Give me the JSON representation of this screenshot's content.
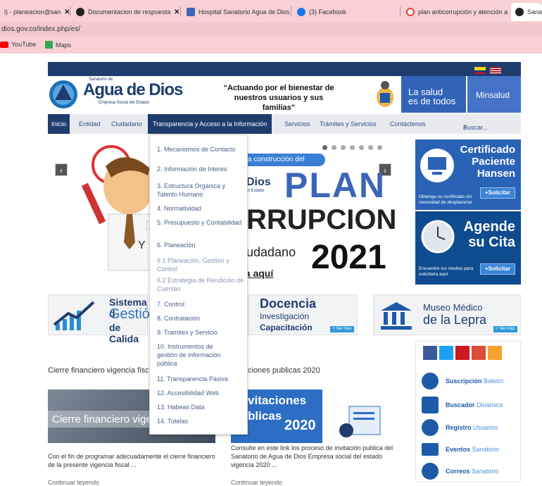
{
  "browser": {
    "tabs": [
      {
        "title": "l) - planeacion@san",
        "favicon_color": "#999999"
      },
      {
        "title": "Documentacion de respuesta",
        "favicon_color": "#222222"
      },
      {
        "title": "Hospital Sanatorio Agua de Dios",
        "favicon_color": "#3b66b8"
      },
      {
        "title": "(3) Facebook",
        "favicon_color": "#1877f2"
      },
      {
        "title": "plan anticorrupción y atención a",
        "favicon_color": "#ea4335"
      },
      {
        "title": "Sanato",
        "favicon_color": "#222222"
      }
    ],
    "tab_close": "✕",
    "url": "dios.gov.co/index.php/es/",
    "bookmarks": [
      {
        "label": "YouTube",
        "color": "#ff0000"
      },
      {
        "label": "Maps",
        "color": "#34a853"
      }
    ]
  },
  "header": {
    "logo_small": "Sanatorio de",
    "logo_main": "Agua de Dios",
    "logo_sub": "Empresa Social del Estado",
    "slogan": "“Actuando por el bienestar de nuestros usuarios y sus familias”",
    "salud_line1": "La salud",
    "salud_line2": "es de todos",
    "minsalud": "Minsalud"
  },
  "nav": {
    "items": [
      "Inicio",
      "Entidad",
      "Ciudadano",
      "Transparencia y Acceso a la Información",
      "Servicios",
      "Trámites y Servicios",
      "Contáctenos"
    ],
    "search_placeholder": "Buscar..."
  },
  "dropdown": {
    "items": [
      "1. Mecanismos de Contacto",
      "2. Información de Interes",
      "3. Estructura Orgánica y Talento Humano",
      "4. Normatividad",
      "5. Presupuesto y Contabilidad",
      "6. Planeación",
      "6.1 Planeación, Gestión y Control",
      "6.2 Estrategia de Rendición de Cuentas",
      "7. Control",
      "8. Contratación",
      "9. Tramites y Servicio",
      "10. Instrumentos de gestión de información pública",
      "11. Transparencia Pasiva",
      "12. Accesibilidad Web",
      "13. Habeas Data",
      "14. Tutelas"
    ]
  },
  "slider": {
    "pill": "a construcción del",
    "logo": "Dios",
    "logo_sub": "el Estado",
    "plan": "PLAN",
    "corr": "RRUPCION",
    "ciudadano": "udadano",
    "year": "2021",
    "aqui": "sa aquí",
    "y": "Y",
    "prev": "‹",
    "next": "›"
  },
  "side": {
    "hansen_title": "Certificado Paciente Hansen",
    "hansen_small": "Obtenga su certificado sin necesidad de desplazarse",
    "solicitar": "+Solicitar",
    "cita_line1": "Agende",
    "cita_line2": "su Cita",
    "cita_small": "Encuentre los medios para solicitarla aquí"
  },
  "banners": {
    "calidad_line1": "Sistema d",
    "calidad_line2": "Gestió",
    "calidad_line3": "de Calida",
    "docencia": "Docencia",
    "inv": "Investigación",
    "cap": "Capacitación",
    "museo1": "Museo Médico",
    "museo2": "de la Lepra",
    "ver_mas": "+ Ver más"
  },
  "sections": {
    "cierre_title": "Cierre financiero vigencia fiscal",
    "cierre_img": "Cierre financiero vige",
    "cierre_text": "Con el fin de programar adecuadamente el cierre financiero de la presente vigencia fiscal ...",
    "inv_title": "ciones publicas 2020",
    "inv_img1": "vitaciones",
    "inv_img2": "blicas",
    "inv_img3": "2020",
    "inv_text": "Consulte en este link los proceso de invitación publica del Sanatorio de Agua de Dios Empresa social del estado vigencia 2020 ...",
    "continuar": "Continuar leyendo"
  },
  "social": {
    "rows": [
      {
        "bold": "Suscripción",
        "light": "Boletín"
      },
      {
        "bold": "Buscador",
        "light": "Dinámico"
      },
      {
        "bold": "Registro",
        "light": "Usuarios"
      },
      {
        "bold": "Eventos",
        "light": "Sanatorio"
      },
      {
        "bold": "Correos",
        "light": "Sanatorio"
      }
    ]
  },
  "colors": {
    "navy": "#1e3d6e",
    "blue": "#3263b9",
    "accent": "#3b66b8"
  }
}
